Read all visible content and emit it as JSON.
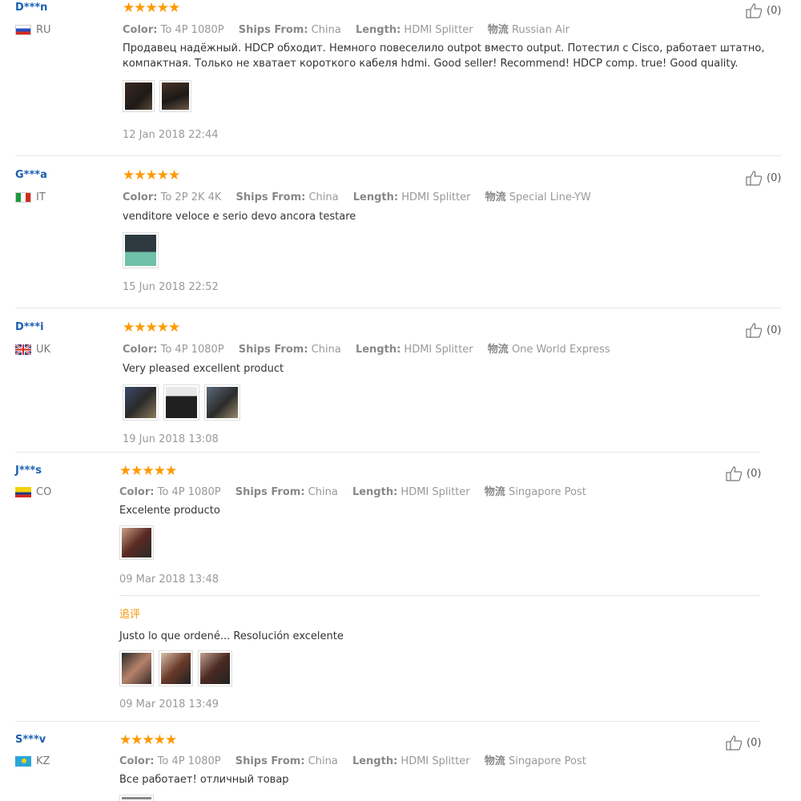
{
  "reviews": [
    {
      "user": "D***n",
      "country": "RU",
      "rating": "★★★★★",
      "color_label": "Color:",
      "color_value": "To 4P 1080P",
      "ships_label": "Ships From:",
      "ships_value": "China",
      "length_label": "Length:",
      "length_value": "HDMI Splitter",
      "logistics_label": "物流",
      "logistics_value": "Russian Air",
      "text": "Продавец надёжный. HDCP обходит. Немного повеселило outpot вместо output. Потестил с Cisco, работает штатно, компактная. Только не хватает короткого кабеля hdmi. Good seller! Recommend! HDCP comp. true! Good quality.",
      "date": "12 Jan 2018 22:44",
      "likes": "(0)"
    },
    {
      "user": "G***a",
      "country": "IT",
      "rating": "★★★★★",
      "color_label": "Color:",
      "color_value": "To 2P 2K 4K",
      "ships_label": "Ships From:",
      "ships_value": "China",
      "length_label": "Length:",
      "length_value": "HDMI Splitter",
      "logistics_label": "物流",
      "logistics_value": "Special Line-YW",
      "text": "venditore veloce e serio devo ancora testare",
      "date": "15 Jun 2018 22:52",
      "likes": "(0)"
    },
    {
      "user": "D***i",
      "country": "UK",
      "rating": "★★★★★",
      "color_label": "Color:",
      "color_value": "To 4P 1080P",
      "ships_label": "Ships From:",
      "ships_value": "China",
      "length_label": "Length:",
      "length_value": "HDMI Splitter",
      "logistics_label": "物流",
      "logistics_value": "One World Express",
      "text": "Very pleased excellent product",
      "date": "19 Jun 2018 13:08",
      "likes": "(0)"
    },
    {
      "user": "J***s",
      "country": "CO",
      "rating": "★★★★★",
      "color_label": "Color:",
      "color_value": "To 4P 1080P",
      "ships_label": "Ships From:",
      "ships_value": "China",
      "length_label": "Length:",
      "length_value": "HDMI Splitter",
      "logistics_label": "物流",
      "logistics_value": "Singapore Post",
      "text": "Excelente producto",
      "date": "09 Mar 2018 13:48",
      "likes": "(0)",
      "followup_label": "追评",
      "followup_text": "Justo lo que ordené... Resolución excelente",
      "followup_date": "09 Mar 2018 13:49"
    },
    {
      "user": "S***v",
      "country": "KZ",
      "rating": "★★★★★",
      "color_label": "Color:",
      "color_value": "To 4P 1080P",
      "ships_label": "Ships From:",
      "ships_value": "China",
      "length_label": "Length:",
      "length_value": "HDMI Splitter",
      "logistics_label": "物流",
      "logistics_value": "Singapore Post",
      "text": "Все работает! отличный товар",
      "likes": "(0)"
    }
  ],
  "colors": {
    "user": "#1a5fb4",
    "star": "#ff9900",
    "followup": "#f29100"
  },
  "icons": {
    "like": "thumbs-up-icon",
    "star": "star-icon"
  }
}
